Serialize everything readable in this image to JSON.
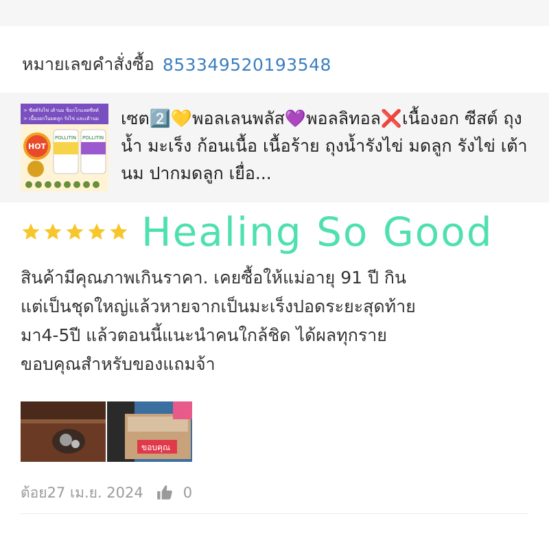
{
  "order": {
    "label": "หมายเลขคำสั่งซื้อ",
    "id": "853349520193548"
  },
  "product": {
    "title": "เซต2️⃣💛พอลเลนพลัส💜พอลลิทอล❌เนื้องอก ซีสต์ ถุงน้ำ มะเร็ง ก้อนเนื้อ เนื้อร้าย ถุงน้ำรังไข่ มดลูก รังไข่ เต้านม ปากมดลูก เยื่อ...",
    "thumb": {
      "line1": "> ซีสต์รังไข่ เต้านม ช็อกโกแลตซีสต์",
      "line2": "> เนื้องอกในมดลูก รังไข่ และเต้านม",
      "badge": "HOT",
      "brand": "POLLITIN"
    }
  },
  "review": {
    "stars": 5,
    "headline": "Healing So Good",
    "lines": [
      "สินค้ามีคุณภาพเกินราคา. เคยซื้อให้แม่อายุ 91 ปี กิน",
      "แต่เป็นชุดใหญ่แล้วหายจากเป็นมะเร็งปอดระยะสุดท้าย",
      "มา4-5ปี แล้วตอนนี้แนะนำคนใกล้ชิด ได้ผลทุกราย",
      "ขอบคุณสำหรับของแถมจ้า"
    ],
    "photo2_label": "ขอบคุณ",
    "meta": {
      "author": "ต้อย",
      "date": "27 เม.ย. 2024",
      "likes": "0"
    }
  },
  "colors": {
    "order_id": "#3b7fbf",
    "headline": "#4fe0b0",
    "star": "#f7c62a"
  },
  "icons": {
    "star": "star-icon",
    "like": "thumbs-up-icon"
  }
}
